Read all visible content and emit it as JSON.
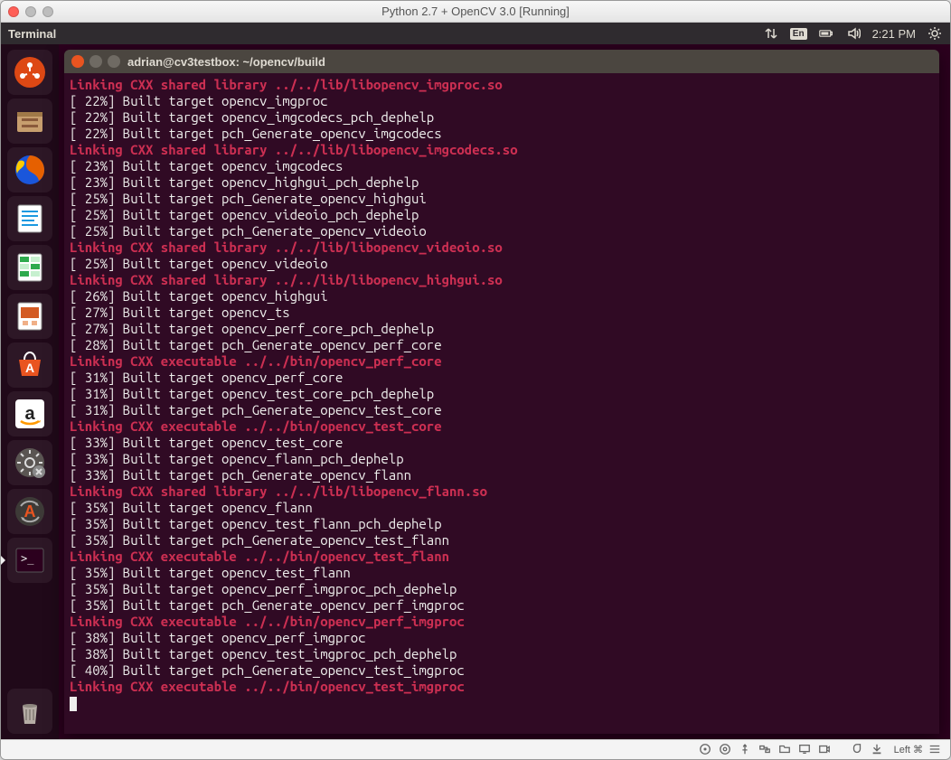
{
  "mac": {
    "title": "Python 2.7 + OpenCV 3.0 [Running]"
  },
  "panel": {
    "app_title": "Terminal",
    "lang": "En",
    "time": "2:21 PM"
  },
  "launcher": {
    "items": [
      {
        "name": "dash",
        "color": "#dd4814"
      },
      {
        "name": "files",
        "color": "#8a5a3b"
      },
      {
        "name": "firefox",
        "color": "#e66000"
      },
      {
        "name": "writer",
        "color": "#1c99e0"
      },
      {
        "name": "calc",
        "color": "#2eaa4d"
      },
      {
        "name": "impress",
        "color": "#d35a23"
      },
      {
        "name": "software-center",
        "color": "#e95420"
      },
      {
        "name": "amazon",
        "color": "#f3f3f3"
      },
      {
        "name": "settings",
        "color": "#5a5552"
      },
      {
        "name": "updater",
        "color": "#3d3a37"
      },
      {
        "name": "terminal",
        "color": "#2c001e",
        "active": true
      },
      {
        "name": "trash",
        "color": "#6b6460"
      }
    ]
  },
  "terminal": {
    "title": "adrian@cv3testbox: ~/opencv/build",
    "lines": [
      {
        "t": "link",
        "text": "Linking CXX shared library ../../lib/libopencv_imgproc.so"
      },
      {
        "t": "normal",
        "text": "[ 22%] Built target opencv_imgproc"
      },
      {
        "t": "normal",
        "text": "[ 22%] Built target opencv_imgcodecs_pch_dephelp"
      },
      {
        "t": "normal",
        "text": "[ 22%] Built target pch_Generate_opencv_imgcodecs"
      },
      {
        "t": "link",
        "text": "Linking CXX shared library ../../lib/libopencv_imgcodecs.so"
      },
      {
        "t": "normal",
        "text": "[ 23%] Built target opencv_imgcodecs"
      },
      {
        "t": "normal",
        "text": "[ 23%] Built target opencv_highgui_pch_dephelp"
      },
      {
        "t": "normal",
        "text": "[ 25%] Built target pch_Generate_opencv_highgui"
      },
      {
        "t": "normal",
        "text": "[ 25%] Built target opencv_videoio_pch_dephelp"
      },
      {
        "t": "normal",
        "text": "[ 25%] Built target pch_Generate_opencv_videoio"
      },
      {
        "t": "link",
        "text": "Linking CXX shared library ../../lib/libopencv_videoio.so"
      },
      {
        "t": "normal",
        "text": "[ 25%] Built target opencv_videoio"
      },
      {
        "t": "link",
        "text": "Linking CXX shared library ../../lib/libopencv_highgui.so"
      },
      {
        "t": "normal",
        "text": "[ 26%] Built target opencv_highgui"
      },
      {
        "t": "normal",
        "text": "[ 27%] Built target opencv_ts"
      },
      {
        "t": "normal",
        "text": "[ 27%] Built target opencv_perf_core_pch_dephelp"
      },
      {
        "t": "normal",
        "text": "[ 28%] Built target pch_Generate_opencv_perf_core"
      },
      {
        "t": "link",
        "text": "Linking CXX executable ../../bin/opencv_perf_core"
      },
      {
        "t": "normal",
        "text": "[ 31%] Built target opencv_perf_core"
      },
      {
        "t": "normal",
        "text": "[ 31%] Built target opencv_test_core_pch_dephelp"
      },
      {
        "t": "normal",
        "text": "[ 31%] Built target pch_Generate_opencv_test_core"
      },
      {
        "t": "link",
        "text": "Linking CXX executable ../../bin/opencv_test_core"
      },
      {
        "t": "normal",
        "text": "[ 33%] Built target opencv_test_core"
      },
      {
        "t": "normal",
        "text": "[ 33%] Built target opencv_flann_pch_dephelp"
      },
      {
        "t": "normal",
        "text": "[ 33%] Built target pch_Generate_opencv_flann"
      },
      {
        "t": "link",
        "text": "Linking CXX shared library ../../lib/libopencv_flann.so"
      },
      {
        "t": "normal",
        "text": "[ 35%] Built target opencv_flann"
      },
      {
        "t": "normal",
        "text": "[ 35%] Built target opencv_test_flann_pch_dephelp"
      },
      {
        "t": "normal",
        "text": "[ 35%] Built target pch_Generate_opencv_test_flann"
      },
      {
        "t": "link",
        "text": "Linking CXX executable ../../bin/opencv_test_flann"
      },
      {
        "t": "normal",
        "text": "[ 35%] Built target opencv_test_flann"
      },
      {
        "t": "normal",
        "text": "[ 35%] Built target opencv_perf_imgproc_pch_dephelp"
      },
      {
        "t": "normal",
        "text": "[ 35%] Built target pch_Generate_opencv_perf_imgproc"
      },
      {
        "t": "link",
        "text": "Linking CXX executable ../../bin/opencv_perf_imgproc"
      },
      {
        "t": "normal",
        "text": "[ 38%] Built target opencv_perf_imgproc"
      },
      {
        "t": "normal",
        "text": "[ 38%] Built target opencv_test_imgproc_pch_dephelp"
      },
      {
        "t": "normal",
        "text": "[ 40%] Built target pch_Generate_opencv_test_imgproc"
      },
      {
        "t": "link",
        "text": "Linking CXX executable ../../bin/opencv_test_imgproc"
      }
    ]
  },
  "statusbar": {
    "host_key": "Left ⌘"
  }
}
